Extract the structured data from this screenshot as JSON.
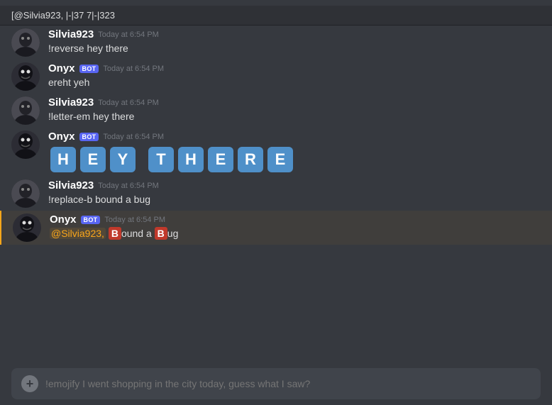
{
  "pinned": {
    "text": "[@Silvia923, |-|37 7|-|323"
  },
  "messages": [
    {
      "id": "msg1",
      "author": "Silvia923",
      "authorType": "user",
      "timestamp": "Today at 6:54 PM",
      "text": "!reverse hey there",
      "type": "plain"
    },
    {
      "id": "msg2",
      "author": "Onyx",
      "authorType": "bot",
      "timestamp": "Today at 6:54 PM",
      "text": "ereht yeh",
      "type": "plain"
    },
    {
      "id": "msg3",
      "author": "Silvia923",
      "authorType": "user",
      "timestamp": "Today at 6:54 PM",
      "text": "!letter-em hey there",
      "type": "plain"
    },
    {
      "id": "msg4",
      "author": "Onyx",
      "authorType": "bot",
      "timestamp": "Today at 6:54 PM",
      "letters": [
        "H",
        "E",
        "Y",
        "T",
        "H",
        "E",
        "R",
        "E"
      ],
      "type": "letters"
    },
    {
      "id": "msg5",
      "author": "Silvia923",
      "authorType": "user",
      "timestamp": "Today at 6:54 PM",
      "text": "!replace-b bound a bug",
      "type": "plain"
    },
    {
      "id": "msg6",
      "author": "Onyx",
      "authorType": "bot",
      "timestamp": "Today at 6:54 PM",
      "type": "replace",
      "mention": "@Silvia923,",
      "parts": [
        "ound a ",
        "ug"
      ]
    }
  ],
  "input": {
    "placeholder": "!emojify I went shopping in the city today, guess what I saw?",
    "add_label": "+"
  },
  "bot_badge": "BOT"
}
